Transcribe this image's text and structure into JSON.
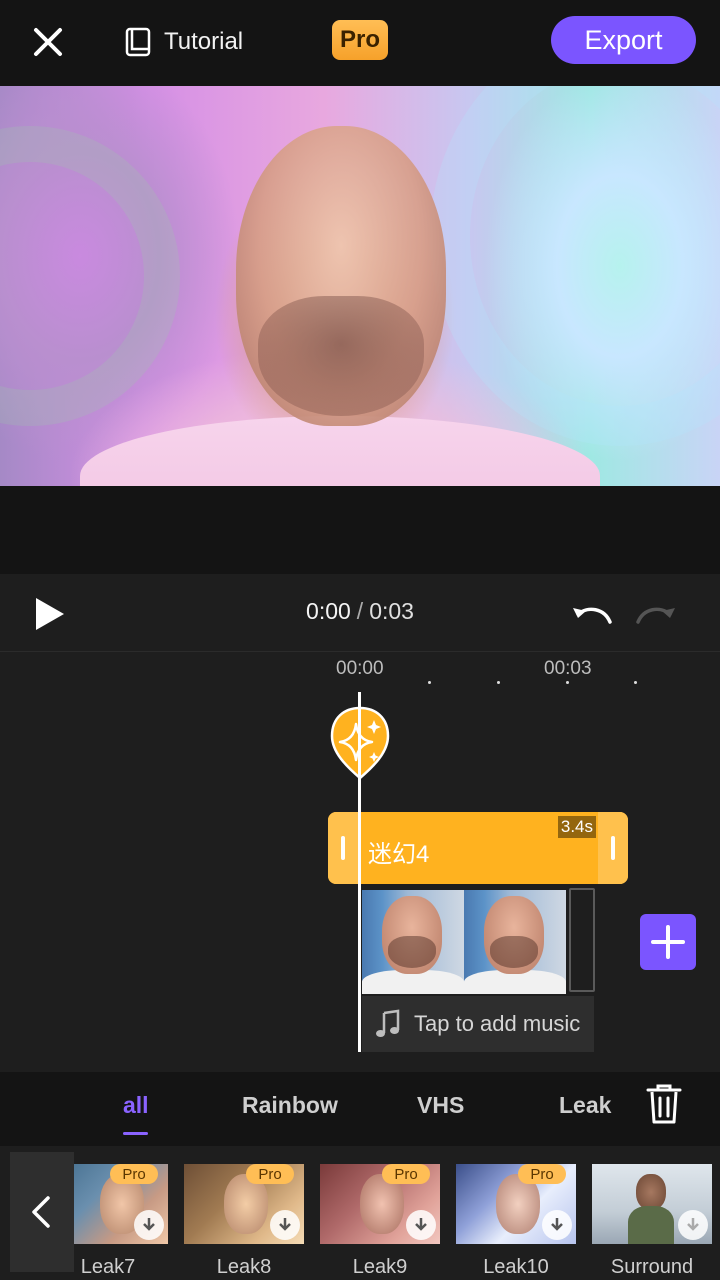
{
  "topbar": {
    "tutorial_label": "Tutorial",
    "pro_label": "Pro",
    "export_label": "Export"
  },
  "playback": {
    "current_time": "0:00",
    "separator": "/",
    "duration": "0:03"
  },
  "timeline": {
    "tick_labels": [
      "00:00",
      "00:03"
    ],
    "effect_clip": {
      "name": "迷幻4",
      "duration": "3.4s"
    },
    "music_placeholder": "Tap to add music"
  },
  "tabs": {
    "items": [
      "all",
      "Rainbow",
      "VHS",
      "Leak"
    ],
    "active_index": 0
  },
  "filters": {
    "items": [
      {
        "label": "Leak7",
        "pro": "Pro"
      },
      {
        "label": "Leak8",
        "pro": "Pro"
      },
      {
        "label": "Leak9",
        "pro": "Pro"
      },
      {
        "label": "Leak10",
        "pro": "Pro"
      },
      {
        "label": "Surround",
        "pro": ""
      }
    ]
  },
  "colors": {
    "accent": "#7b55ff",
    "tab_active": "#8a63ff",
    "effect_track": "#ffb21f",
    "pro_badge": "#ffbe55",
    "background": "#141414"
  },
  "icons": {
    "close": "close-icon",
    "tutorial": "book-icon",
    "play": "play-icon",
    "undo": "undo-icon",
    "redo": "redo-icon",
    "effect": "sparkle-icon",
    "add": "plus-icon",
    "music": "music-note-icon",
    "trash": "trash-icon",
    "back": "chevron-left-icon",
    "download": "download-icon"
  }
}
